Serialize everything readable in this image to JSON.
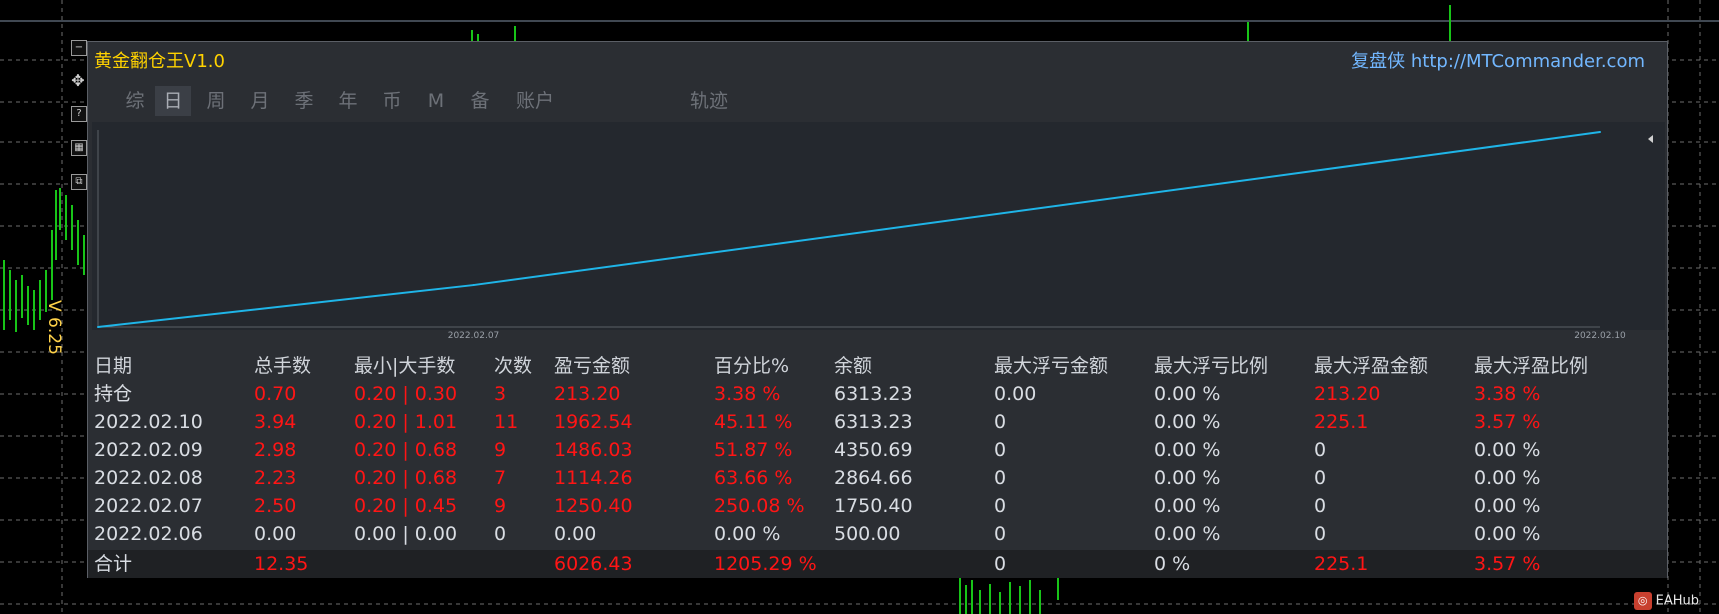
{
  "window": {
    "title": "黄金翻仓王V1.0",
    "brand": "复盘侠 http://MTCommander.com",
    "version_label": "V 6.25"
  },
  "tabs": [
    {
      "label": "综"
    },
    {
      "label": "日",
      "active": true
    },
    {
      "label": "周"
    },
    {
      "label": "月"
    },
    {
      "label": "季"
    },
    {
      "label": "年"
    },
    {
      "label": "币"
    },
    {
      "label": "M"
    },
    {
      "label": "备"
    },
    {
      "label": "账户"
    },
    {
      "label": "轨迹"
    }
  ],
  "chart_data": {
    "type": "line",
    "x": [
      "2022.02.06",
      "2022.02.07",
      "2022.02.10"
    ],
    "tick_labels": [
      "2022.02.07",
      "2022.02.10"
    ],
    "series": [
      {
        "values": [
          500.0,
          1750.4,
          6313.23
        ]
      }
    ],
    "color": "#1fb5e8"
  },
  "table": {
    "headers": [
      "日期",
      "总手数",
      "最小|大手数",
      "次数",
      "盈亏金额",
      "百分比%",
      "余额",
      "最大浮亏金额",
      "最大浮亏比例",
      "最大浮盈金额",
      "最大浮盈比例"
    ],
    "rows": [
      [
        "持仓",
        "0.70",
        "0.20 | 0.30",
        "3",
        "213.20",
        "3.38 %",
        "6313.23",
        "0.00",
        "0.00 %",
        "213.20",
        "3.38 %"
      ],
      [
        "2022.02.10",
        "3.94",
        "0.20 | 1.01",
        "11",
        "1962.54",
        "45.11 %",
        "6313.23",
        "0",
        "0.00 %",
        "225.1",
        "3.57 %"
      ],
      [
        "2022.02.09",
        "2.98",
        "0.20 | 0.68",
        "9",
        "1486.03",
        "51.87 %",
        "4350.69",
        "0",
        "0.00 %",
        "0",
        "0.00 %"
      ],
      [
        "2022.02.08",
        "2.23",
        "0.20 | 0.68",
        "7",
        "1114.26",
        "63.66 %",
        "2864.66",
        "0",
        "0.00 %",
        "0",
        "0.00 %"
      ],
      [
        "2022.02.07",
        "2.50",
        "0.20 | 0.45",
        "9",
        "1250.40",
        "250.08 %",
        "1750.40",
        "0",
        "0.00 %",
        "0",
        "0.00 %"
      ],
      [
        "2022.02.06",
        "0.00",
        "0.00 | 0.00",
        "0",
        "0.00",
        "0.00 %",
        "500.00",
        "0",
        "0.00 %",
        "0",
        "0.00 %"
      ]
    ],
    "row_red_mask": [
      [
        false,
        true,
        true,
        true,
        true,
        true,
        false,
        false,
        false,
        true,
        true
      ],
      [
        false,
        true,
        true,
        true,
        true,
        true,
        false,
        false,
        false,
        true,
        true
      ],
      [
        false,
        true,
        true,
        true,
        true,
        true,
        false,
        false,
        false,
        false,
        false
      ],
      [
        false,
        true,
        true,
        true,
        true,
        true,
        false,
        false,
        false,
        false,
        false
      ],
      [
        false,
        true,
        true,
        true,
        true,
        true,
        false,
        false,
        false,
        false,
        false
      ],
      [
        false,
        false,
        false,
        false,
        false,
        false,
        false,
        false,
        false,
        false,
        false
      ]
    ],
    "total": [
      "合计",
      "12.35",
      "",
      "",
      "6026.43",
      "1205.29 %",
      "",
      "0",
      "0 %",
      "225.1",
      "3.57 %"
    ],
    "total_red_mask": [
      false,
      true,
      false,
      false,
      true,
      true,
      false,
      false,
      false,
      true,
      true
    ]
  },
  "footer": {
    "logo_text": "EAHub"
  },
  "colors": {
    "accent_line": "#1fb5e8",
    "loss_profit_red": "#ff1515",
    "title_yellow": "#ffd200",
    "brand_blue": "#72b7ff",
    "candle_green": "#18c418"
  }
}
